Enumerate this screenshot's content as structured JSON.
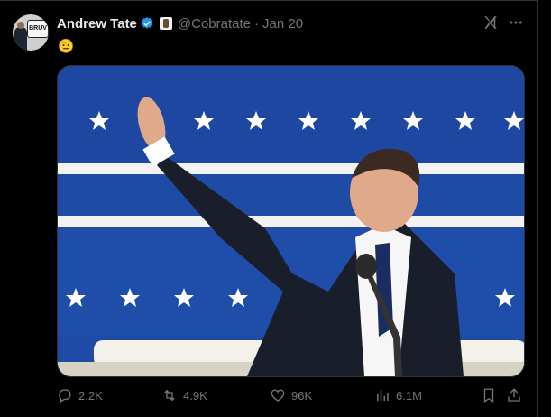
{
  "tweet": {
    "author_name": "Andrew Tate",
    "handle": "@Cobratate",
    "separator": "·",
    "date": "Jan 20",
    "avatar_badge_text": "BRUV",
    "body_emoji": "saluting-face-emoji",
    "verified_color": "#1d9bf0",
    "media": {
      "subject": "man in dark suit with raised right arm before a microphone",
      "background_colors": [
        "#1f4aa8",
        "#ffffff",
        "#c62828"
      ]
    }
  },
  "actions": {
    "replies": "2.2K",
    "reposts": "4.9K",
    "likes": "96K",
    "views": "6.1M"
  },
  "icons": [
    "verified-badge-icon",
    "affiliate-badge-icon",
    "grok-icon",
    "more-icon",
    "reply-icon",
    "repost-icon",
    "like-icon",
    "views-icon",
    "bookmark-icon",
    "share-icon"
  ]
}
